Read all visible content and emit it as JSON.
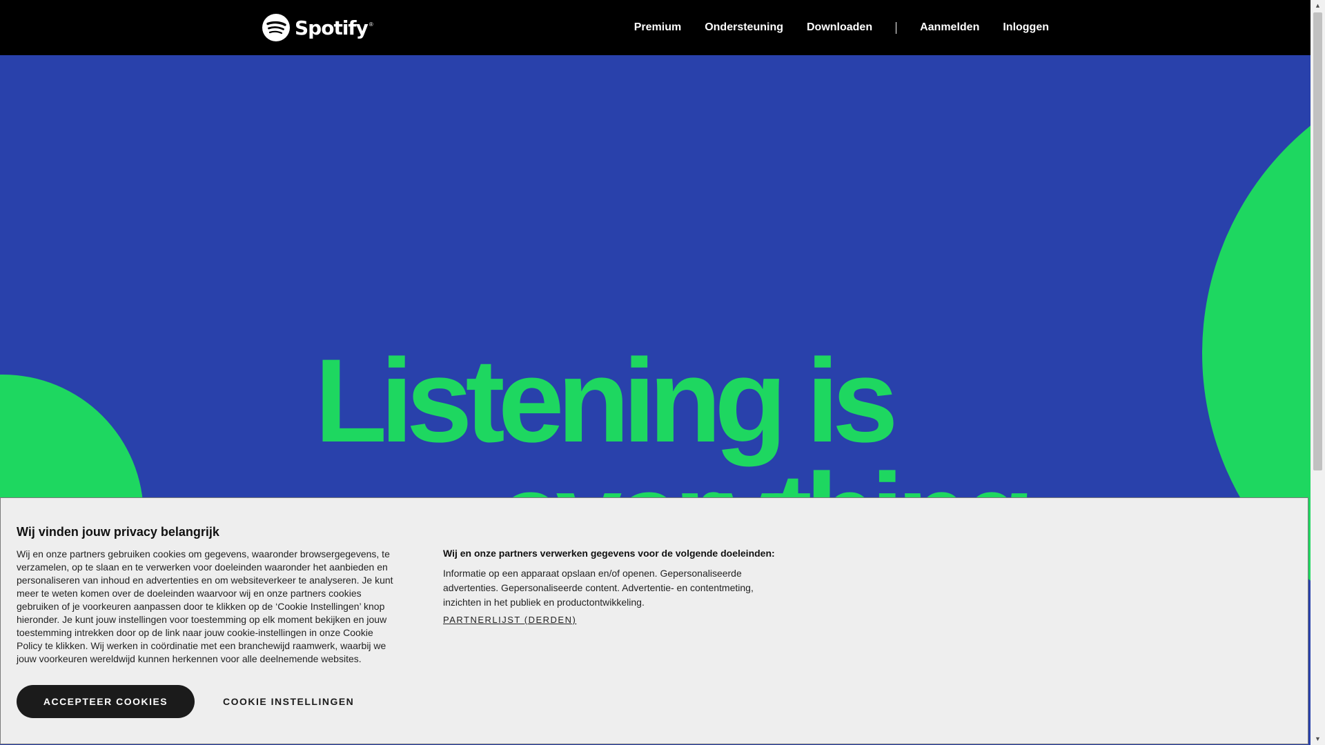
{
  "brand": {
    "name": "Spotify",
    "trademark": "®"
  },
  "nav": {
    "premium": "Premium",
    "support": "Ondersteuning",
    "download": "Downloaden",
    "separator": "|",
    "signup": "Aanmelden",
    "login": "Inloggen"
  },
  "hero": {
    "line1": "Listening is",
    "line2": "everything"
  },
  "cookie": {
    "title": "Wij vinden jouw privacy belangrijk",
    "body": "Wij en onze partners gebruiken cookies om gegevens, waaronder browsergegevens, te verzamelen, op te slaan en te verwerken voor doeleinden waaronder het aanbieden en personaliseren van inhoud en advertenties en om websiteverkeer te analyseren. Je kunt meer te weten komen over de doeleinden waarvoor wij en onze partners cookies gebruiken of je voorkeuren aanpassen door te klikken op de ‘Cookie Instellingen’ knop hieronder. Je kunt jouw instellingen voor toestemming op elk moment bekijken en jouw toestemming intrekken door op de link naar jouw cookie-instellingen in onze Cookie Policy te klikken. Wij werken in coördinatie met een branchewijd raamwerk, waarbij we jouw voorkeuren wereldwijd kunnen herkennen voor alle deelnemende websites.",
    "purpose_title": "Wij en onze partners verwerken gegevens voor de volgende doeleinden:",
    "purpose_text": "Informatie op een apparaat opslaan en/of openen. Gepersonaliseerde advertenties. Gepersonaliseerde content. Advertentie- en contentmeting, inzichten in het publiek en productontwikkeling.",
    "partners_link": "PARTNERLIJST (DERDEN)",
    "accept_button": "ACCEPTEER COOKIES",
    "settings_button": "COOKIE INSTELLINGEN"
  },
  "scrollbar": {
    "up_arrow": "▲",
    "down_arrow": "▼"
  },
  "colors": {
    "hero_background": "#2941ab",
    "accent_green": "#1ed760",
    "navbar": "#000000",
    "cookie_background": "#eeeeee"
  }
}
